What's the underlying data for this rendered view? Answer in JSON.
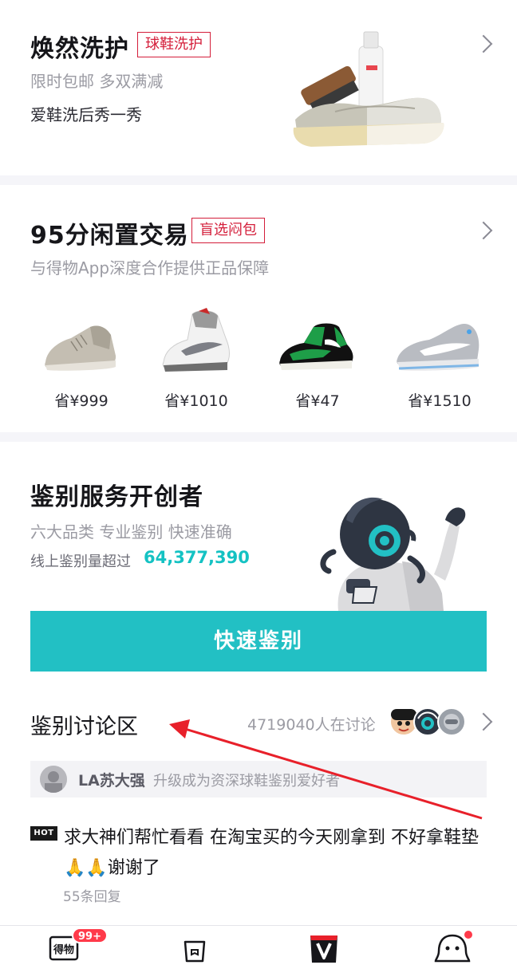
{
  "wash": {
    "title": "焕然洗护",
    "tag": "球鞋洗护",
    "subtitle": "限时包邮 多双满减",
    "tagline": "爱鞋洗后秀一秀"
  },
  "trade": {
    "title": "95分闲置交易",
    "tag": "盲选闷包",
    "subtitle": "与得物App深度合作提供正品保障",
    "items": [
      {
        "save": "省¥999",
        "icon": "shoe-suede-high-top"
      },
      {
        "save": "省¥1010",
        "icon": "shoe-white-basketball"
      },
      {
        "save": "省¥47",
        "icon": "shoe-green-jordan"
      },
      {
        "save": "省¥1510",
        "icon": "shoe-gray-runner"
      }
    ]
  },
  "auth": {
    "title": "鉴别服务开创者",
    "subtitle": "六大品类 专业鉴别 快速准确",
    "stat_label": "线上鉴别量超过",
    "stat_value": "64,377,390",
    "button": "快速鉴别"
  },
  "discussion": {
    "title": "鉴别讨论区",
    "count_text": "4719040人在讨论",
    "notice_user": "LA苏大强",
    "notice_text": "升级成为资深球鞋鉴别爱好者",
    "hot_label": "HOT",
    "post_line1": "求大神们帮忙看看 在淘宝买的今天刚拿到 不好拿鞋垫",
    "post_line2": "🙏🙏谢谢了",
    "replies": "55条回复"
  },
  "tabbar": {
    "home_label": "得物",
    "home_badge": "99+"
  },
  "colors": {
    "accent": "#22c0c4",
    "stat": "#14c2c3",
    "tag_red": "#d41e3a",
    "badge_red": "#ff3a4a",
    "annotation": "#e8202a"
  }
}
